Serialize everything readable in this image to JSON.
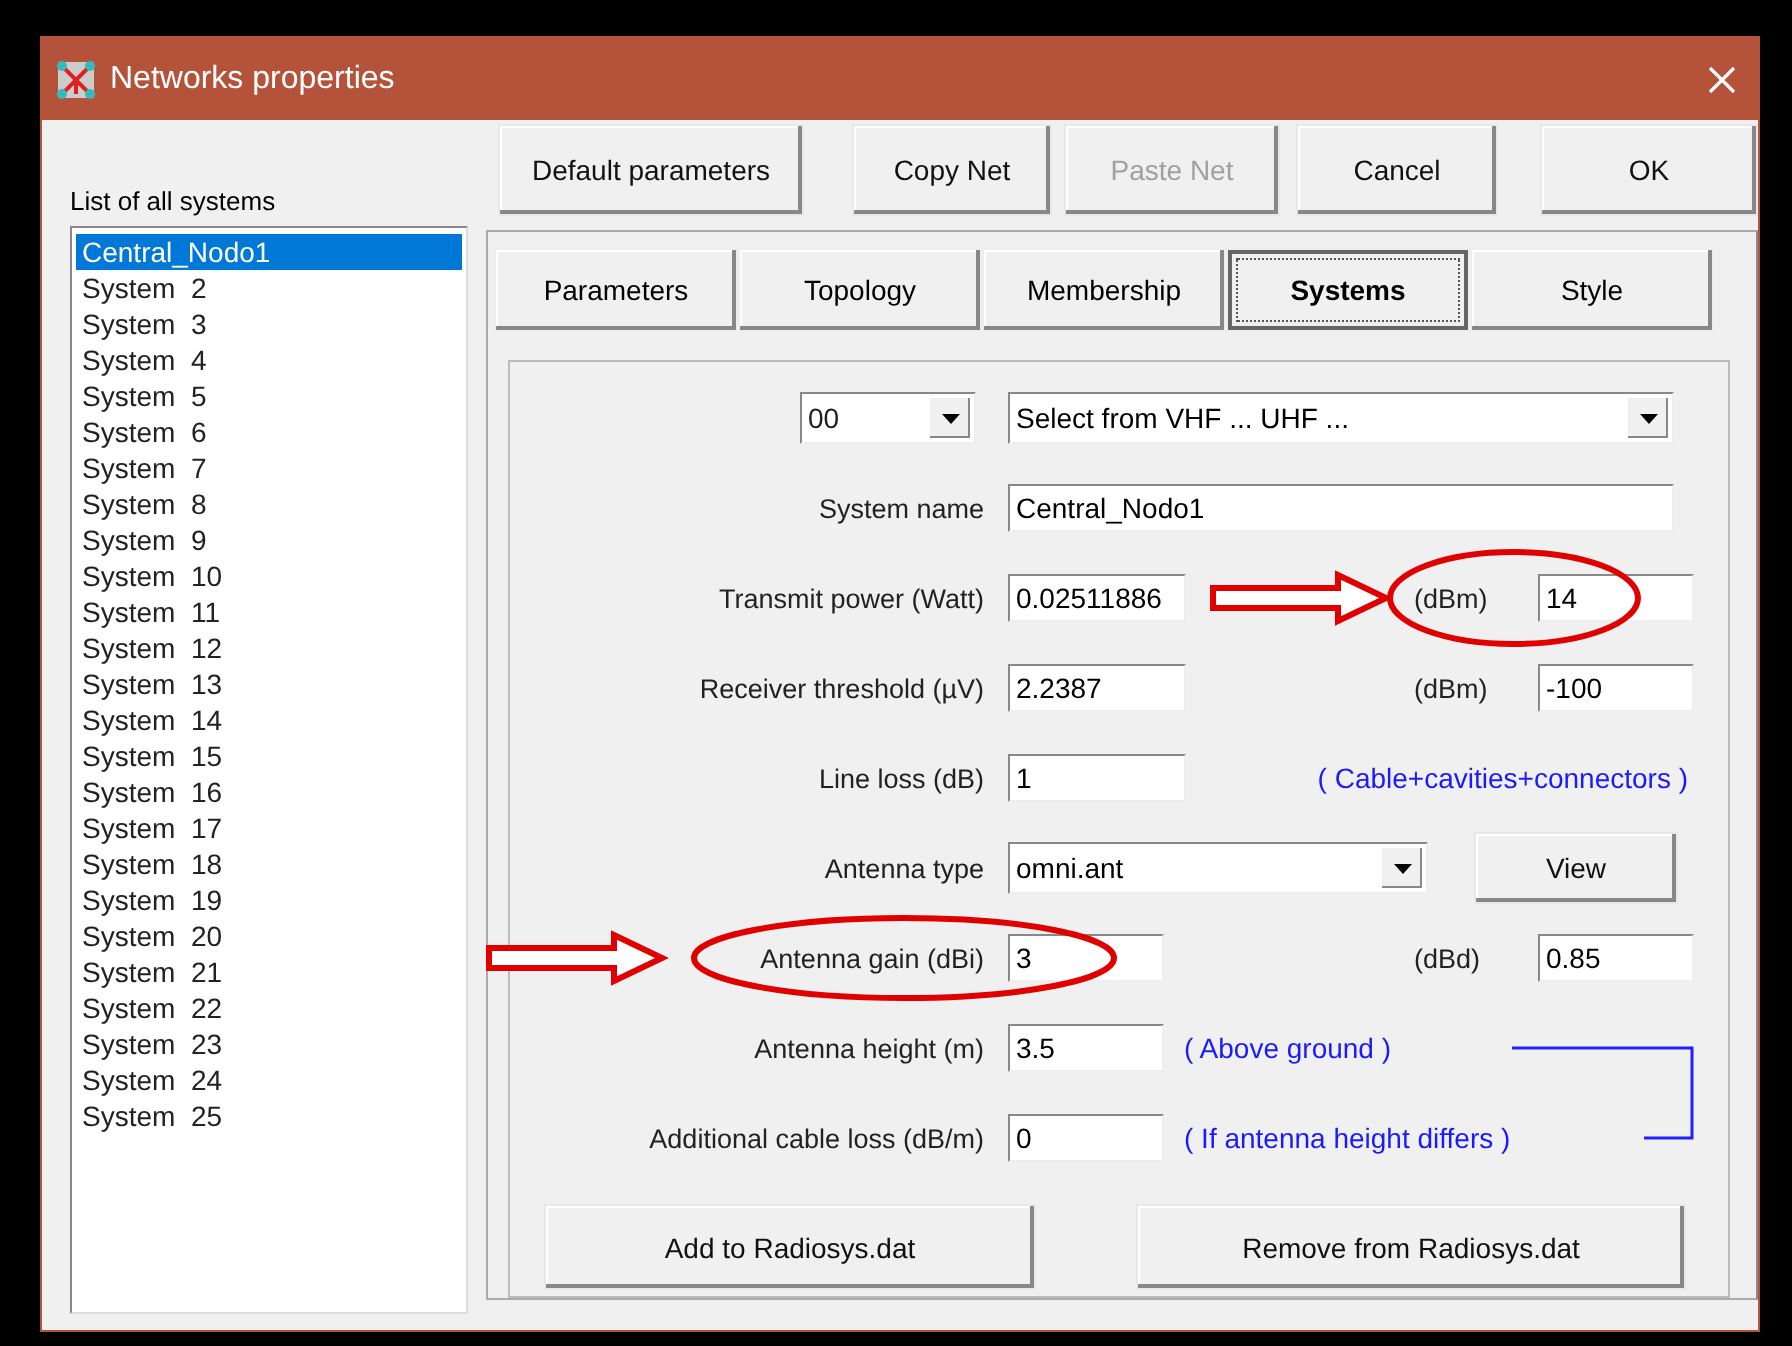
{
  "window": {
    "title": "Networks properties"
  },
  "systems_list": {
    "label": "List of all systems",
    "items": [
      {
        "name": "Central_Nodo1",
        "selected": true
      },
      {
        "name": "System  2",
        "selected": false
      },
      {
        "name": "System  3",
        "selected": false
      },
      {
        "name": "System  4",
        "selected": false
      },
      {
        "name": "System  5",
        "selected": false
      },
      {
        "name": "System  6",
        "selected": false
      },
      {
        "name": "System  7",
        "selected": false
      },
      {
        "name": "System  8",
        "selected": false
      },
      {
        "name": "System  9",
        "selected": false
      },
      {
        "name": "System  10",
        "selected": false
      },
      {
        "name": "System  11",
        "selected": false
      },
      {
        "name": "System  12",
        "selected": false
      },
      {
        "name": "System  13",
        "selected": false
      },
      {
        "name": "System  14",
        "selected": false
      },
      {
        "name": "System  15",
        "selected": false
      },
      {
        "name": "System  16",
        "selected": false
      },
      {
        "name": "System  17",
        "selected": false
      },
      {
        "name": "System  18",
        "selected": false
      },
      {
        "name": "System  19",
        "selected": false
      },
      {
        "name": "System  20",
        "selected": false
      },
      {
        "name": "System  21",
        "selected": false
      },
      {
        "name": "System  22",
        "selected": false
      },
      {
        "name": "System  23",
        "selected": false
      },
      {
        "name": "System  24",
        "selected": false
      },
      {
        "name": "System  25",
        "selected": false
      }
    ]
  },
  "buttons": [
    {
      "label": "Default parameters",
      "disabled": false
    },
    {
      "label": "Copy Net",
      "disabled": false
    },
    {
      "label": "Paste Net",
      "disabled": true
    },
    {
      "label": "Cancel",
      "disabled": false
    },
    {
      "label": "OK",
      "disabled": false
    }
  ],
  "tabs": [
    {
      "label": "Parameters",
      "selected": false
    },
    {
      "label": "Topology",
      "selected": false
    },
    {
      "label": "Membership",
      "selected": false
    },
    {
      "label": "Systems",
      "selected": true
    },
    {
      "label": "Style",
      "selected": false
    }
  ],
  "systems_tab": {
    "selectors": [
      {
        "value": "00"
      },
      {
        "value": "Select from VHF ... UHF ..."
      }
    ],
    "rows": [
      {
        "kind": "text",
        "label": "System name",
        "value": "Central_Nodo1"
      },
      {
        "kind": "pair",
        "label": "Transmit power (Watt)",
        "value": "0.02511886",
        "unit": "(dBm)",
        "unit_value": "14",
        "circle_unit": true
      },
      {
        "kind": "pair",
        "label": "Receiver threshold (µV)",
        "value": "2.2387",
        "unit": "(dBm)",
        "unit_value": "-100"
      },
      {
        "kind": "note",
        "label": "Line loss (dB)",
        "value": "1",
        "note": "( Cable+cavities+connectors )",
        "note_right": true
      },
      {
        "kind": "combo",
        "label": "Antenna type",
        "value": "omni.ant",
        "button": "View"
      },
      {
        "kind": "pair",
        "label": "Antenna gain (dBi)",
        "value": "3",
        "unit": "(dBd)",
        "unit_value": "0.85",
        "circle_label": true
      },
      {
        "kind": "note",
        "label": "Antenna height (m)",
        "value": "3.5",
        "note": "( Above ground )",
        "bracket_start": true
      },
      {
        "kind": "note",
        "label": "Additional cable loss (dB/m)",
        "value": "0",
        "note": "( If antenna height differs )"
      }
    ],
    "actions": [
      "Add to Radiosys.dat",
      "Remove from Radiosys.dat"
    ]
  }
}
